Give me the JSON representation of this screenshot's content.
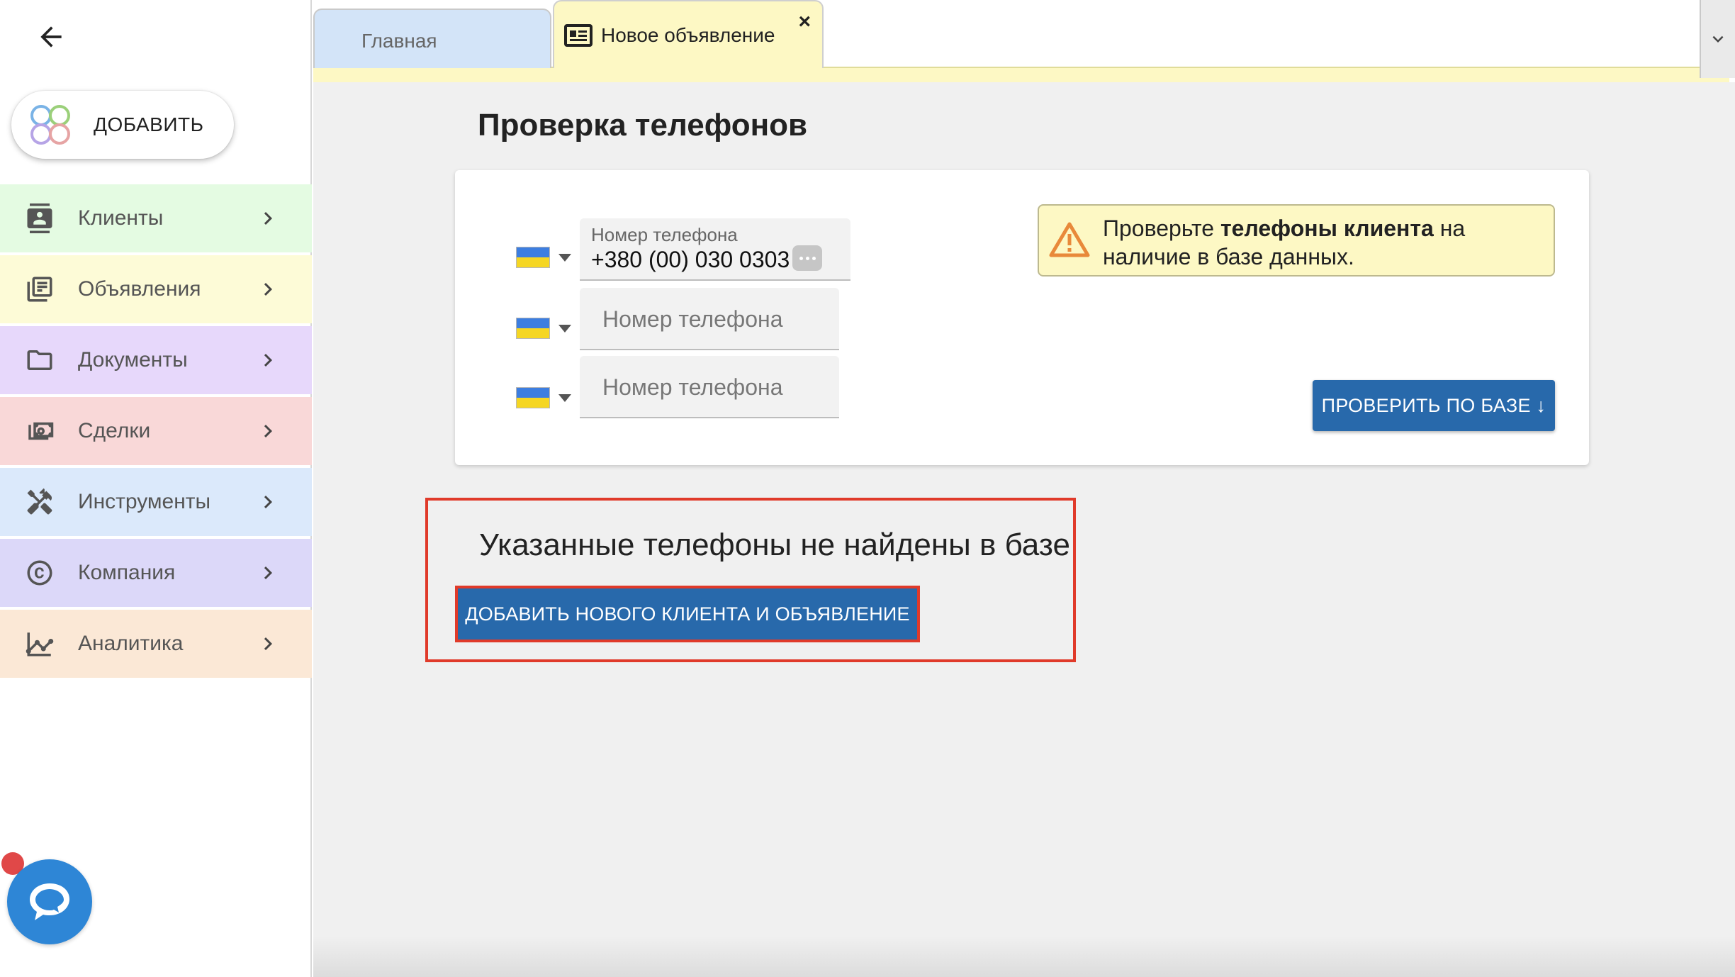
{
  "sidebar": {
    "add_button_label": "ДОБАВИТЬ",
    "items": [
      {
        "label": "Клиенты",
        "icon": "contacts-icon",
        "color": "#e4fbe2"
      },
      {
        "label": "Объявления",
        "icon": "listing-icon",
        "color": "#fdfbd7"
      },
      {
        "label": "Документы",
        "icon": "folder-icon",
        "color": "#e7d8fb"
      },
      {
        "label": "Сделки",
        "icon": "money-icon",
        "color": "#f9d8d8"
      },
      {
        "label": "Инструменты",
        "icon": "tools-icon",
        "color": "#dbe9fb"
      },
      {
        "label": "Компания",
        "icon": "copyright-icon",
        "color": "#dcd8f9"
      },
      {
        "label": "Аналитика",
        "icon": "analytics-icon",
        "color": "#fbe8d6"
      }
    ]
  },
  "tabs": {
    "home": "Главная",
    "new_listing": "Новое объявление",
    "close": "×"
  },
  "phone_check": {
    "title": "Проверка телефонов",
    "field_label": "Номер телефона",
    "phone1_value": "+380 (00) 030 0303",
    "phone2_placeholder": "Номер телефона",
    "phone3_placeholder": "Номер телефона",
    "alert_prefix": "Проверьте ",
    "alert_bold": "телефоны клиента",
    "alert_suffix": " на наличие в базе данных.",
    "check_button": "ПРОВЕРИТЬ ПО БАЗЕ ↓"
  },
  "result": {
    "title": "Указанные телефоны не найдены в базе",
    "add_button": "ДОБАВИТЬ НОВОГО КЛИЕНТА И ОБЪЯВЛЕНИЕ"
  },
  "colors": {
    "primary": "#2869ab",
    "highlight": "#e03a2a",
    "tab_active": "#fdf8c4",
    "tab_home": "#d3e4f8",
    "chat": "#2e86d6"
  }
}
